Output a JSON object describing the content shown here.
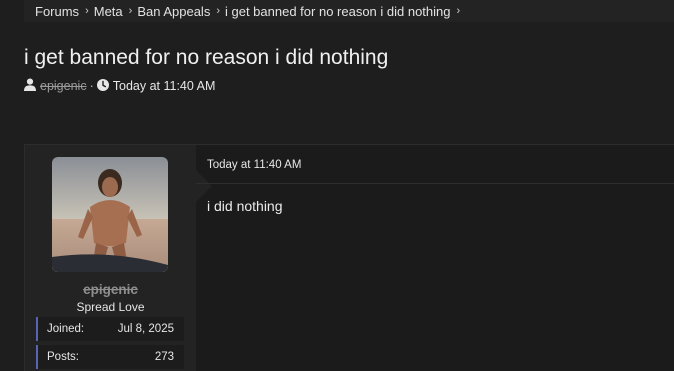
{
  "breadcrumb": {
    "items": [
      {
        "label": "Forums"
      },
      {
        "label": "Meta"
      },
      {
        "label": "Ban Appeals"
      },
      {
        "label": "i get banned for no reason i did nothing"
      }
    ]
  },
  "thread": {
    "title": "i get banned for no reason i did nothing",
    "author": "epigenic",
    "separator": "·",
    "timestamp": "Today at 11:40 AM"
  },
  "post": {
    "user": {
      "name": "epigenic",
      "title": "Spread Love",
      "stats": {
        "joined_label": "Joined:",
        "joined_value": "Jul 8, 2025",
        "posts_label": "Posts:",
        "posts_value": "273"
      }
    },
    "date": "Today at 11:40 AM",
    "body": "i did nothing"
  },
  "icons": {
    "user": "user-icon",
    "clock": "clock-icon",
    "chevron": "chevron-right-icon"
  },
  "colors": {
    "background": "#1e1e1e",
    "panel": "#232323",
    "stat_accent": "#5865b5"
  }
}
